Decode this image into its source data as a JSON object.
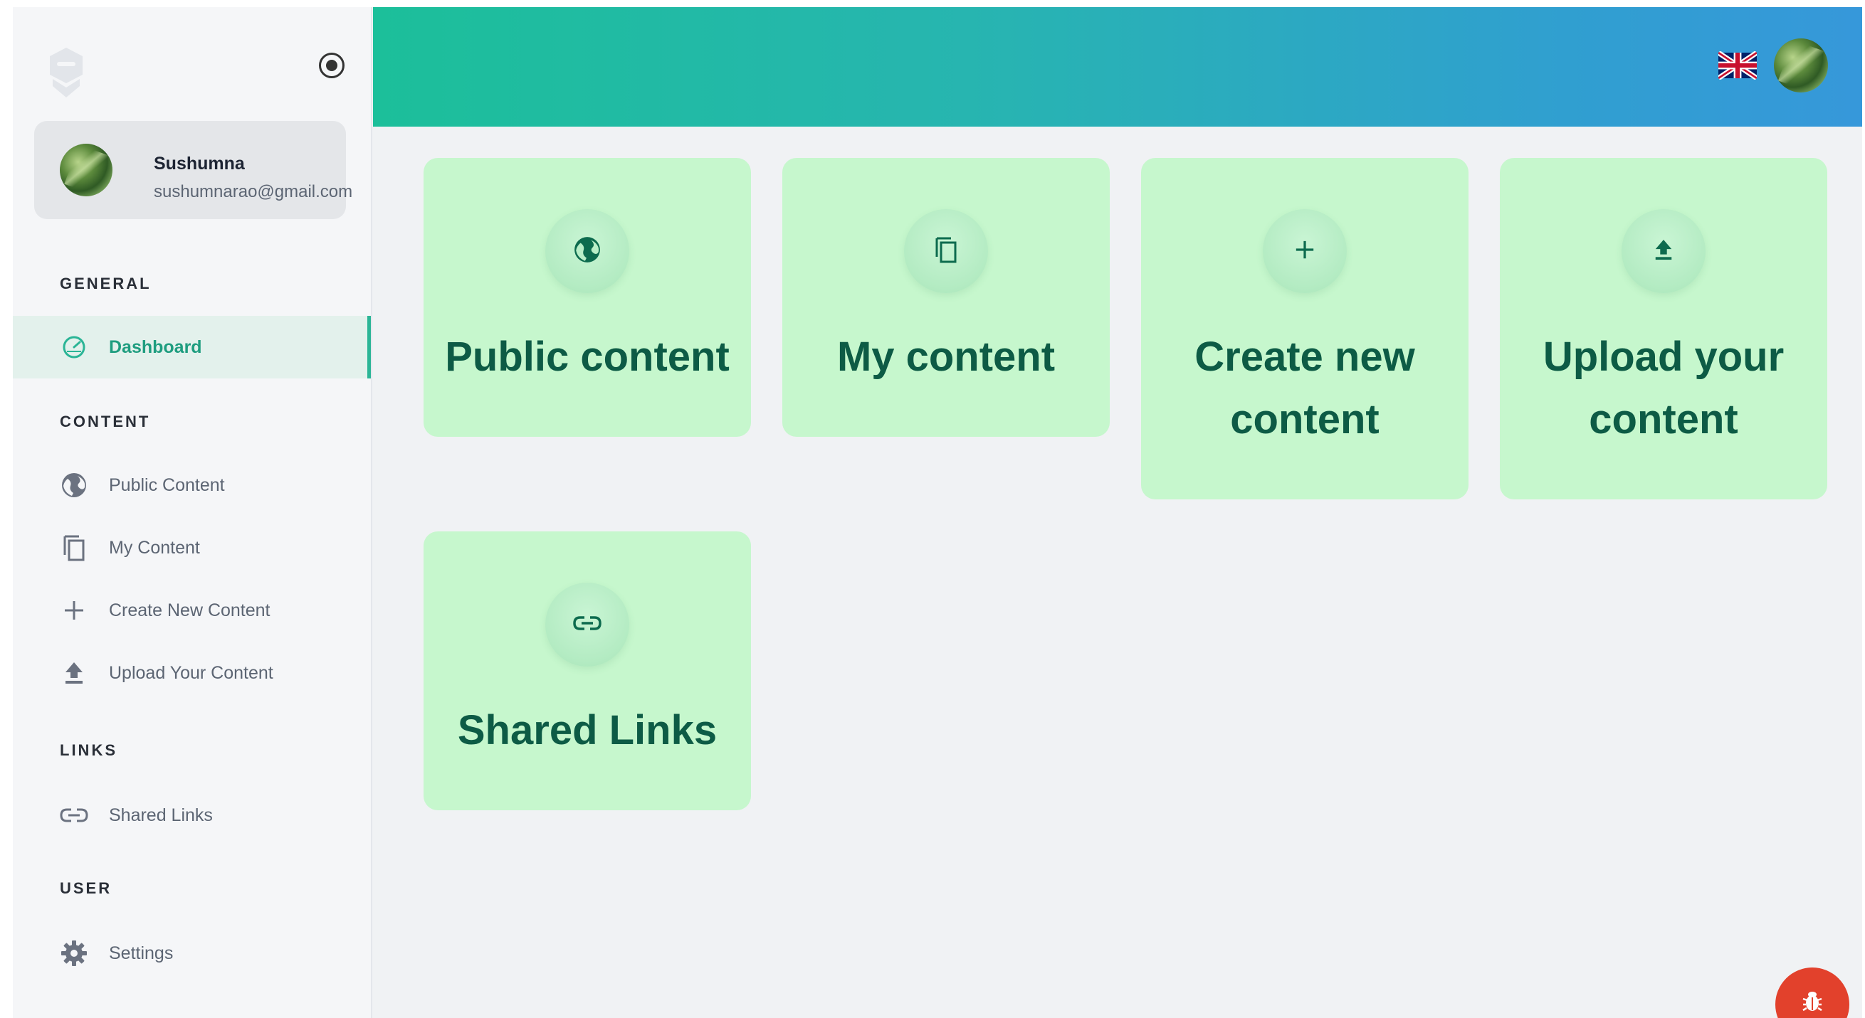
{
  "sidebar": {
    "user": {
      "name": "Sushumna",
      "email": "sushumnarao@gmail.com"
    },
    "sections": {
      "general": "GENERAL",
      "content": "CONTENT",
      "links": "LINKS",
      "user": "USER"
    },
    "items": {
      "dashboard": {
        "label": "Dashboard",
        "icon": "speedometer-icon",
        "active": true
      },
      "public_content": {
        "label": "Public Content",
        "icon": "globe-icon"
      },
      "my_content": {
        "label": "My Content",
        "icon": "copy-icon"
      },
      "create_new_content": {
        "label": "Create New Content",
        "icon": "plus-icon"
      },
      "upload_your_content": {
        "label": "Upload Your Content",
        "icon": "upload-icon"
      },
      "shared_links": {
        "label": "Shared Links",
        "icon": "link-icon"
      },
      "settings": {
        "label": "Settings",
        "icon": "gear-icon"
      }
    }
  },
  "header": {
    "language_flag": "uk-flag-icon"
  },
  "cards": {
    "public_content": {
      "title": "Public content",
      "icon": "globe-icon"
    },
    "my_content": {
      "title": "My content",
      "icon": "copy-icon"
    },
    "create_new_content": {
      "title": "Create new content",
      "icon": "plus-icon"
    },
    "upload_your_content": {
      "title": "Upload your content",
      "icon": "upload-icon"
    },
    "shared_links": {
      "title": "Shared Links",
      "icon": "link-icon"
    }
  },
  "colors": {
    "accent": "#2bb596",
    "card_bg": "#c6f7cd",
    "card_text": "#0d5b45",
    "header_gradient_start": "#1cbf9a",
    "header_gradient_end": "#3698da",
    "fab": "#e2412c"
  }
}
